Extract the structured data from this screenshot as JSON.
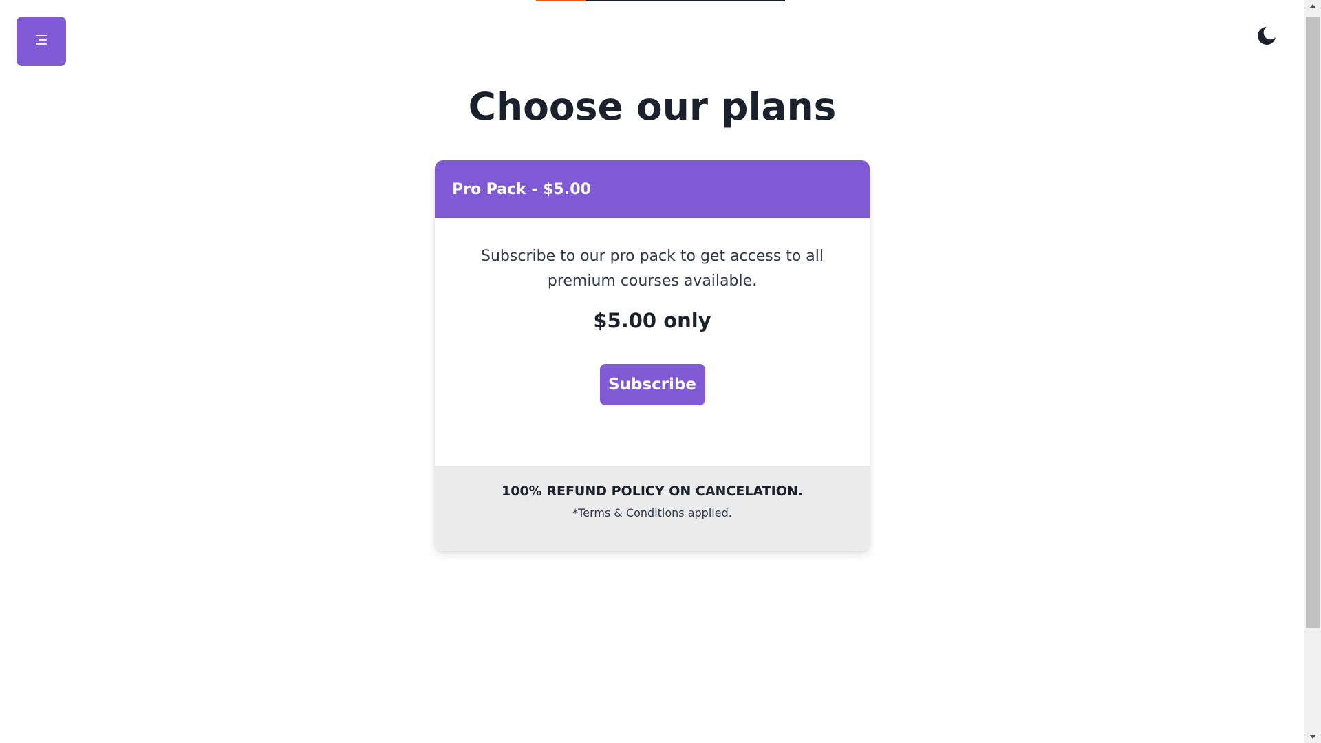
{
  "progress": {
    "fraction": 0.2
  },
  "nav": {
    "menu_icon": "menu-icon",
    "theme_icon": "moon-icon"
  },
  "page": {
    "title": "Choose our plans"
  },
  "plan": {
    "header": "Pro Pack - $5.00",
    "description": "Subscribe to our pro pack to get access to all premium courses available.",
    "price": "$5.00 only",
    "button_label": "Subscribe",
    "refund_policy": "100% REFUND POLICY ON CANCELATION.",
    "terms": "*Terms & Conditions applied."
  },
  "colors": {
    "accent": "#805ad5",
    "text": "#1a202c",
    "footer_bg": "#ebebeb",
    "progress": "#e8590c"
  }
}
